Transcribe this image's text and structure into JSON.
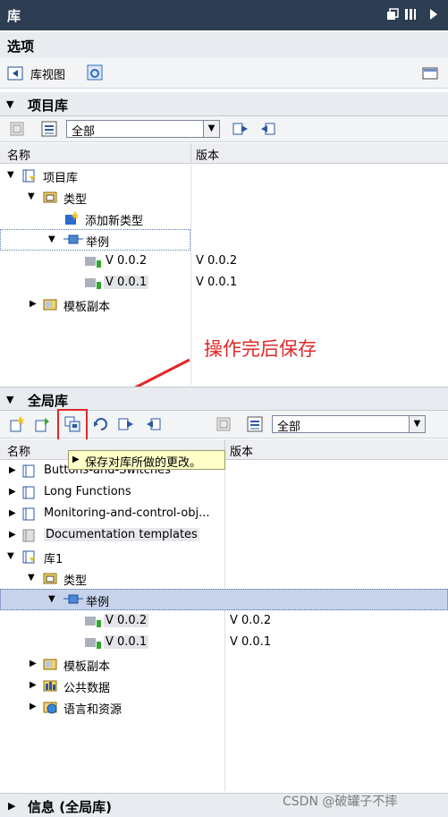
{
  "window": {
    "title": "库"
  },
  "options": {
    "title": "选项",
    "library_view_label": "库视图"
  },
  "project_library": {
    "title": "项目库",
    "filter_value": "全部",
    "columns": {
      "name": "名称",
      "version": "版本"
    },
    "tree": {
      "root": "项目库",
      "types": "类型",
      "add_new_type": "添加新类型",
      "example": "举例",
      "v1": "V 0.0.2",
      "v1_ver": "V 0.0.2",
      "v2": "V 0.0.1",
      "v2_ver": "V 0.0.1",
      "master_copies": "模板副本"
    }
  },
  "annotation": {
    "text": "操作完后保存"
  },
  "global_library": {
    "title": "全局库",
    "filter_value": "全部",
    "columns": {
      "name": "名称",
      "version": "版本"
    },
    "tooltip": "保存对库所做的更改。",
    "tree": {
      "lib_a": "Buttons-and-Switches",
      "lib_b": "Long Functions",
      "lib_c": "Monitoring-and-control-obj...",
      "lib_d": "Documentation templates",
      "lib1": "库1",
      "types": "类型",
      "example": "举例",
      "v1": "V 0.0.2",
      "v1_ver": "V 0.0.2",
      "v2": "V 0.0.1",
      "v2_ver": "V 0.0.1",
      "master_copies": "模板副本",
      "common_data": "公共数据",
      "languages": "语言和资源"
    }
  },
  "info": {
    "title": "信息 (全局库)"
  },
  "watermark": "CSDN @破罐子不摔"
}
